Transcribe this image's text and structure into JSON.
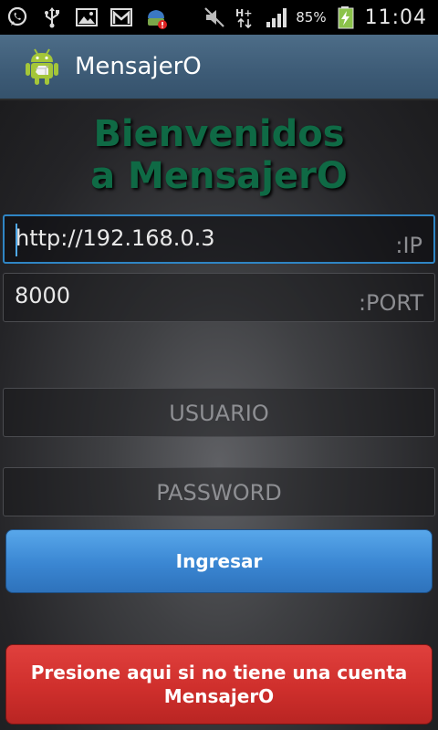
{
  "status_bar": {
    "icons": [
      "whatsapp-icon",
      "usb-icon",
      "gallery-icon",
      "gmail-icon",
      "cleaner-icon",
      "mute-icon",
      "hplus-network-icon",
      "signal-icon"
    ],
    "network_label": "H+",
    "battery_percent": "85%",
    "battery_level": 0.85,
    "time": "11:04"
  },
  "action_bar": {
    "title": "MensajerO"
  },
  "main": {
    "welcome_title": "Bienvenidos a MensajerO",
    "ip_field": {
      "value": "http://192.168.0.3",
      "hint": ":IP"
    },
    "port_field": {
      "value": "8000",
      "hint": ":PORT"
    },
    "user_field": {
      "placeholder": "USUARIO"
    },
    "password_field": {
      "placeholder": "PASSWORD"
    },
    "login_button": "Ingresar",
    "register_button": "Presione aqui si no tiene una cuenta MensajerO"
  },
  "colors": {
    "title_green": "#0f6a45",
    "login_blue": "#3a86d2",
    "register_red": "#cf2f2c",
    "focus_blue": "#2f85c4"
  }
}
